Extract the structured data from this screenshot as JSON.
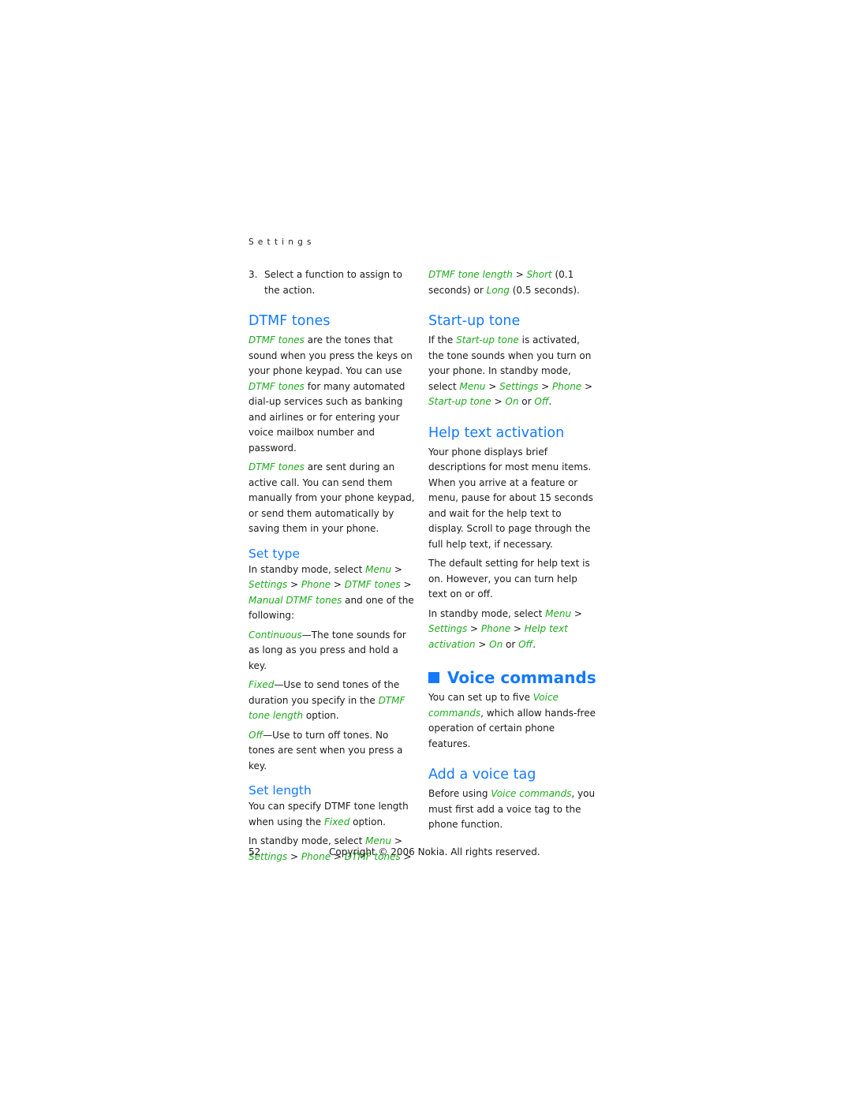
{
  "running_head": "Settings",
  "left": {
    "step3_num": "3.",
    "step3_text": "Select a function to assign to the action.",
    "dtmf_heading": "DTMF tones",
    "dtmf_p1": [
      "DTMF tones",
      " are the tones that sound when you press the keys on your phone keypad. You can use ",
      "DTMF tones",
      " for many automated dial-up services such as banking and airlines or for entering your voice mailbox number and password."
    ],
    "dtmf_p2": [
      "DTMF tones",
      " are sent during an active call. You can send them manually from your phone keypad, or send them automatically by saving them in your phone."
    ],
    "settype_heading": "Set type",
    "settype_p1": [
      "In standby mode, select ",
      "Menu",
      " > ",
      "Settings",
      " > ",
      "Phone",
      " > ",
      "DTMF tones",
      " > ",
      "Manual DTMF tones",
      " and one of the following:"
    ],
    "continuous": [
      "Continuous",
      "—The tone sounds for as long as you press and hold a key."
    ],
    "fixed": [
      "Fixed",
      "—Use to send tones of the duration you specify in the ",
      "DTMF tone length",
      " option."
    ],
    "off": [
      "Off",
      "—Use to turn off tones. No tones are sent when you press a key."
    ],
    "setlength_heading": "Set length",
    "setlength_p1": [
      "You can specify DTMF tone length when using the ",
      "Fixed",
      " option."
    ],
    "setlength_p2": [
      "In standby mode, select ",
      "Menu",
      " > ",
      "Settings",
      " > ",
      "Phone",
      " > ",
      "DTMF tones",
      " >"
    ]
  },
  "right": {
    "cont_p": [
      "DTMF tone length",
      " > ",
      "Short",
      " (0.1 seconds) or ",
      "Long",
      " (0.5 seconds)."
    ],
    "startup_heading": "Start-up tone",
    "startup_p": [
      "If the ",
      "Start-up tone",
      " is activated, the tone sounds when you turn on your phone. In standby mode, select ",
      "Menu",
      " > ",
      "Settings",
      " > ",
      "Phone",
      " > ",
      "Start-up tone",
      " > ",
      "On",
      " or ",
      "Off",
      "."
    ],
    "help_heading": "Help text activation",
    "help_p1": "Your phone displays brief descriptions for most menu items. When you arrive at a feature or menu, pause for about 15 seconds and wait for the help text to display. Scroll to page through the full help text, if necessary.",
    "help_p2": "The default setting for help text is on. However, you can turn help text on or off.",
    "help_p3": [
      "In standby mode, select ",
      "Menu",
      " > ",
      "Settings",
      " > ",
      "Phone",
      " > ",
      "Help text activation",
      " > ",
      "On",
      " or ",
      "Off",
      "."
    ],
    "voice_heading": "Voice commands",
    "voice_p": [
      "You can set up to five ",
      "Voice commands",
      ", which allow hands-free operation of certain phone features."
    ],
    "addtag_heading": "Add a voice tag",
    "addtag_p": [
      "Before using ",
      "Voice commands",
      ", you must first add a voice tag to the phone function."
    ]
  },
  "footer": {
    "page_number": "52",
    "copyright": "Copyright © 2006 Nokia. All rights reserved."
  }
}
